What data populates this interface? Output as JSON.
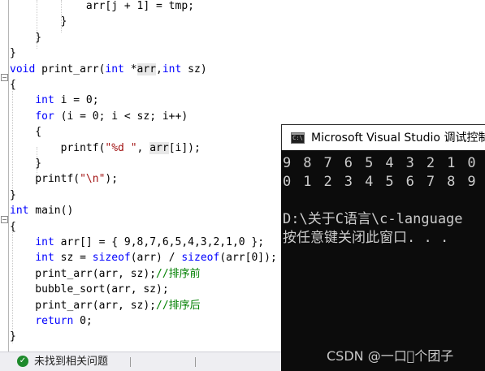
{
  "editor": {
    "lines": [
      {
        "segs": [
          {
            "t": "            arr[j + 1] = tmp;",
            "c": ""
          }
        ]
      },
      {
        "segs": [
          {
            "t": "        }",
            "c": ""
          }
        ]
      },
      {
        "segs": [
          {
            "t": "    }",
            "c": ""
          }
        ]
      },
      {
        "segs": [
          {
            "t": "}",
            "c": ""
          }
        ]
      },
      {
        "segs": [
          {
            "t": "void",
            "c": "kw"
          },
          {
            "t": " print_arr(",
            "c": ""
          },
          {
            "t": "int",
            "c": "kw"
          },
          {
            "t": " *",
            "c": ""
          },
          {
            "t": "arr",
            "c": "hl"
          },
          {
            "t": ",",
            "c": ""
          },
          {
            "t": "int",
            "c": "kw"
          },
          {
            "t": " sz)",
            "c": ""
          }
        ]
      },
      {
        "segs": [
          {
            "t": "{",
            "c": ""
          }
        ]
      },
      {
        "segs": [
          {
            "t": "    ",
            "c": ""
          },
          {
            "t": "int",
            "c": "kw"
          },
          {
            "t": " i = 0;",
            "c": ""
          }
        ]
      },
      {
        "segs": [
          {
            "t": "    ",
            "c": ""
          },
          {
            "t": "for",
            "c": "kw"
          },
          {
            "t": " (i = 0; i < sz; i++)",
            "c": ""
          }
        ]
      },
      {
        "segs": [
          {
            "t": "    {",
            "c": ""
          }
        ]
      },
      {
        "segs": [
          {
            "t": "        printf(",
            "c": ""
          },
          {
            "t": "\"%d \"",
            "c": "str"
          },
          {
            "t": ", ",
            "c": ""
          },
          {
            "t": "arr",
            "c": "hl"
          },
          {
            "t": "[i]);",
            "c": ""
          }
        ]
      },
      {
        "segs": [
          {
            "t": "    }",
            "c": ""
          }
        ]
      },
      {
        "segs": [
          {
            "t": "    printf(",
            "c": ""
          },
          {
            "t": "\"\\n\"",
            "c": "str"
          },
          {
            "t": ");",
            "c": ""
          }
        ]
      },
      {
        "segs": [
          {
            "t": "}",
            "c": ""
          }
        ]
      },
      {
        "segs": [
          {
            "t": "int",
            "c": "kw"
          },
          {
            "t": " main()",
            "c": ""
          }
        ]
      },
      {
        "segs": [
          {
            "t": "{",
            "c": ""
          }
        ]
      },
      {
        "segs": [
          {
            "t": "    ",
            "c": ""
          },
          {
            "t": "int",
            "c": "kw"
          },
          {
            "t": " arr[] = { 9,8,7,6,5,4,3,2,1,0 };",
            "c": ""
          }
        ]
      },
      {
        "segs": [
          {
            "t": "    ",
            "c": ""
          },
          {
            "t": "int",
            "c": "kw"
          },
          {
            "t": " sz = ",
            "c": ""
          },
          {
            "t": "sizeof",
            "c": "kw"
          },
          {
            "t": "(arr) / ",
            "c": ""
          },
          {
            "t": "sizeof",
            "c": "kw"
          },
          {
            "t": "(arr[0]);",
            "c": ""
          }
        ]
      },
      {
        "segs": [
          {
            "t": "    print_arr(arr, sz);",
            "c": ""
          },
          {
            "t": "//排序前",
            "c": "cmt"
          }
        ]
      },
      {
        "segs": [
          {
            "t": "    bubble_sort(arr, sz);",
            "c": ""
          }
        ]
      },
      {
        "segs": [
          {
            "t": "    print_arr(arr, sz);",
            "c": ""
          },
          {
            "t": "//排序后",
            "c": "cmt"
          }
        ]
      },
      {
        "segs": [
          {
            "t": "    ",
            "c": ""
          },
          {
            "t": "return",
            "c": "kw"
          },
          {
            "t": " 0;",
            "c": ""
          }
        ]
      },
      {
        "segs": [
          {
            "t": "}",
            "c": ""
          }
        ]
      }
    ],
    "fold_markers": [
      "−",
      "−"
    ]
  },
  "console": {
    "icon_text": "C:\\",
    "title": "Microsoft Visual Studio 调试控制台",
    "output": [
      "9 8 7 6 5 4 3 2 1 0",
      "0 1 2 3 4 5 6 7 8 9",
      "",
      "D:\\关于C语言\\c-language",
      "按任意键关闭此窗口. . ."
    ],
    "watermark": "CSDN @一口\u0000个团子"
  },
  "status": {
    "icon": "✓",
    "text": "未找到相关问题"
  },
  "colors": {
    "keyword": "#0000ff",
    "string": "#a31515",
    "comment": "#008000",
    "console_bg": "#0c0c0c",
    "console_text": "#cccccc",
    "status_ok": "#1e8a2c"
  }
}
